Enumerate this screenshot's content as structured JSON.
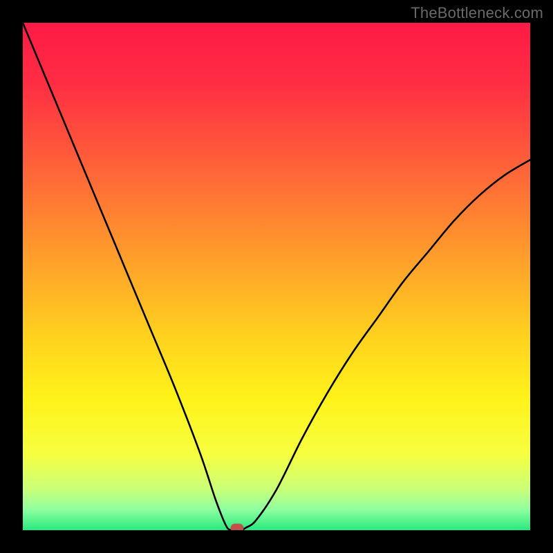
{
  "watermark": "TheBottleneck.com",
  "gradient_stops": [
    {
      "offset": 0.0,
      "color": "#ff1a46"
    },
    {
      "offset": 0.12,
      "color": "#ff2e43"
    },
    {
      "offset": 0.28,
      "color": "#ff6139"
    },
    {
      "offset": 0.45,
      "color": "#ff9a2c"
    },
    {
      "offset": 0.62,
      "color": "#ffd21e"
    },
    {
      "offset": 0.74,
      "color": "#fff21a"
    },
    {
      "offset": 0.85,
      "color": "#f6ff3f"
    },
    {
      "offset": 0.92,
      "color": "#c9ff79"
    },
    {
      "offset": 0.96,
      "color": "#8dffa0"
    },
    {
      "offset": 1.0,
      "color": "#27e97e"
    }
  ],
  "curve_color": "#000000",
  "curve_width": 2.6,
  "marker_color": "#c1534b",
  "chart_data": {
    "type": "line",
    "title": "",
    "xlabel": "",
    "ylabel": "",
    "xlim": [
      0,
      100
    ],
    "ylim": [
      0,
      100
    ],
    "series": [
      {
        "name": "bottleneck-curve",
        "x": [
          0,
          5,
          10,
          15,
          20,
          25,
          30,
          35,
          38,
          40,
          41,
          42,
          43,
          44,
          46,
          50,
          55,
          60,
          65,
          70,
          75,
          80,
          85,
          90,
          95,
          100
        ],
        "y": [
          100,
          88,
          76,
          64,
          52,
          40,
          28,
          15,
          6,
          1,
          0,
          0,
          0,
          0.5,
          2,
          8,
          18,
          27,
          35,
          42,
          49,
          55,
          61,
          66,
          70,
          73
        ]
      }
    ],
    "marker": {
      "x": 42.3,
      "y": 0.4
    },
    "note": "On-screen values estimated from pixel positions; axes are unlabeled so x/y treated as 0–100 percent of plot width/height."
  }
}
